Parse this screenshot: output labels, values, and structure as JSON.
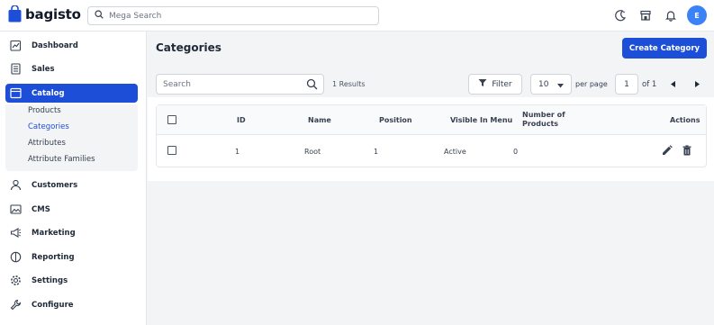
{
  "header": {
    "logo_text": "bagisto",
    "search_placeholder": "Mega Search",
    "avatar_initial": "E",
    "icons": [
      "moon-icon",
      "store-icon",
      "bell-icon"
    ]
  },
  "sidebar": {
    "items": [
      {
        "label": "Dashboard",
        "icon": "dashboard-icon"
      },
      {
        "label": "Sales",
        "icon": "receipt-icon"
      },
      {
        "label": "Catalog",
        "icon": "catalog-icon",
        "active": true
      },
      {
        "label": "Customers",
        "icon": "user-icon"
      },
      {
        "label": "CMS",
        "icon": "image-icon"
      },
      {
        "label": "Marketing",
        "icon": "megaphone-icon"
      },
      {
        "label": "Reporting",
        "icon": "chart-icon"
      },
      {
        "label": "Settings",
        "icon": "gear-icon"
      },
      {
        "label": "Configure",
        "icon": "wrench-icon"
      }
    ],
    "catalog_children": [
      {
        "label": "Products"
      },
      {
        "label": "Categories",
        "current": true
      },
      {
        "label": "Attributes"
      },
      {
        "label": "Attribute Families"
      }
    ]
  },
  "main": {
    "title": "Categories",
    "create_button": "Create Category",
    "toolbar": {
      "search_placeholder": "Search",
      "results": "1 Results",
      "filter_label": "Filter",
      "per_page_value": "10",
      "per_page_label": "per page",
      "current_page": "1",
      "of_pages": "of 1"
    },
    "table": {
      "columns": [
        "ID",
        "Name",
        "Position",
        "Visible In Menu",
        "Number of Products",
        "Actions"
      ],
      "number_of_products_lines": [
        "Number of",
        "Products"
      ],
      "rows": [
        {
          "id": "1",
          "name": "Root",
          "position": "1",
          "visible": "Active",
          "products": "0"
        }
      ]
    }
  },
  "colors": {
    "primary": "#1d4ed8",
    "avatar": "#3b82f6",
    "background": "#f3f4f6"
  }
}
